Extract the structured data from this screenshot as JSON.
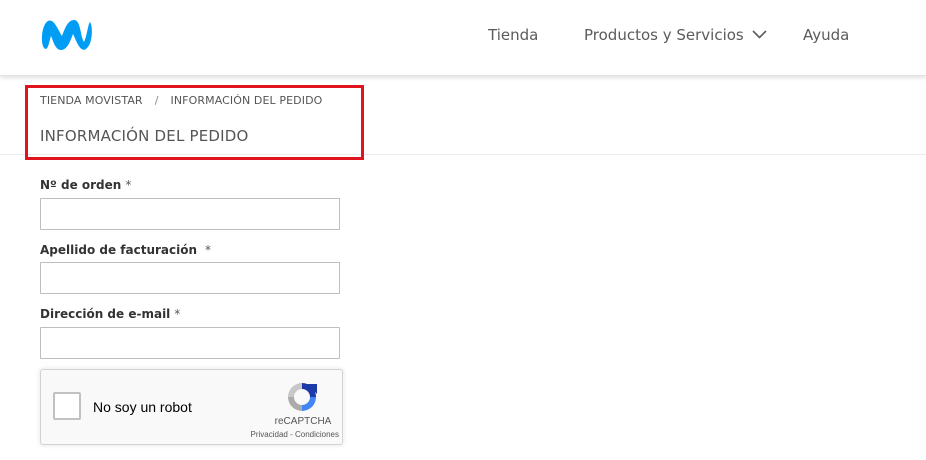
{
  "header": {
    "logo_icon": "movistar-m-logo",
    "brand_color": "#019df4",
    "nav": {
      "tienda": "Tienda",
      "productos": "Productos y Servicios",
      "ayuda": "Ayuda"
    }
  },
  "breadcrumb": {
    "home": "TIENDA MOVISTAR",
    "separator": "/",
    "current": "INFORMACIÓN DEL PEDIDO"
  },
  "page_title": "INFORMACIÓN DEL PEDIDO",
  "highlight_color": "#e0141e",
  "form": {
    "order_number": {
      "label": "Nº de orden",
      "required": "*",
      "value": ""
    },
    "billing_surname": {
      "label": "Apellido de facturación",
      "required": "*",
      "value": ""
    },
    "email": {
      "label": "Dirección de e-mail",
      "required": "*",
      "value": ""
    }
  },
  "recaptcha": {
    "label": "No soy un robot",
    "brand": "reCAPTCHA",
    "privacy": "Privacidad",
    "dash": " - ",
    "terms": "Condiciones"
  }
}
